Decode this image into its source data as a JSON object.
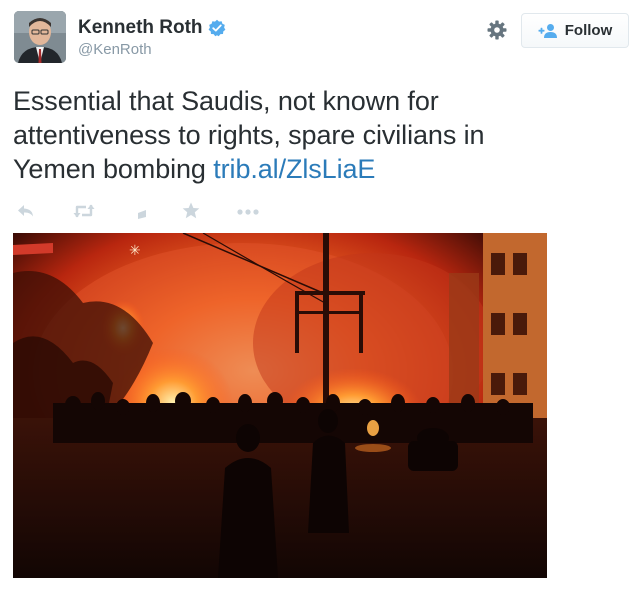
{
  "author": {
    "display_name": "Kenneth Roth",
    "handle": "@KenRoth",
    "verified": true
  },
  "header": {
    "follow_label": "Follow",
    "settings_icon": "gear-icon",
    "follow_icon": "add-user-icon"
  },
  "tweet": {
    "text_line1": "Essential that Saudis, not known for",
    "text_line2": "attentiveness to rights, spare civilians in",
    "text_line3_prefix": "Yemen bombing ",
    "link": "trib.al/ZlsLiaE"
  },
  "actions": [
    {
      "name": "reply",
      "icon": "reply-icon"
    },
    {
      "name": "retweet",
      "icon": "retweet-icon"
    },
    {
      "name": "bookmark",
      "icon": "bookmark-icon"
    },
    {
      "name": "favorite",
      "icon": "star-icon"
    },
    {
      "name": "more",
      "icon": "more-icon"
    }
  ],
  "colors": {
    "link": "#2b7bb9",
    "verified": "#55acee",
    "muted": "#8899a6",
    "text": "#292f33"
  }
}
